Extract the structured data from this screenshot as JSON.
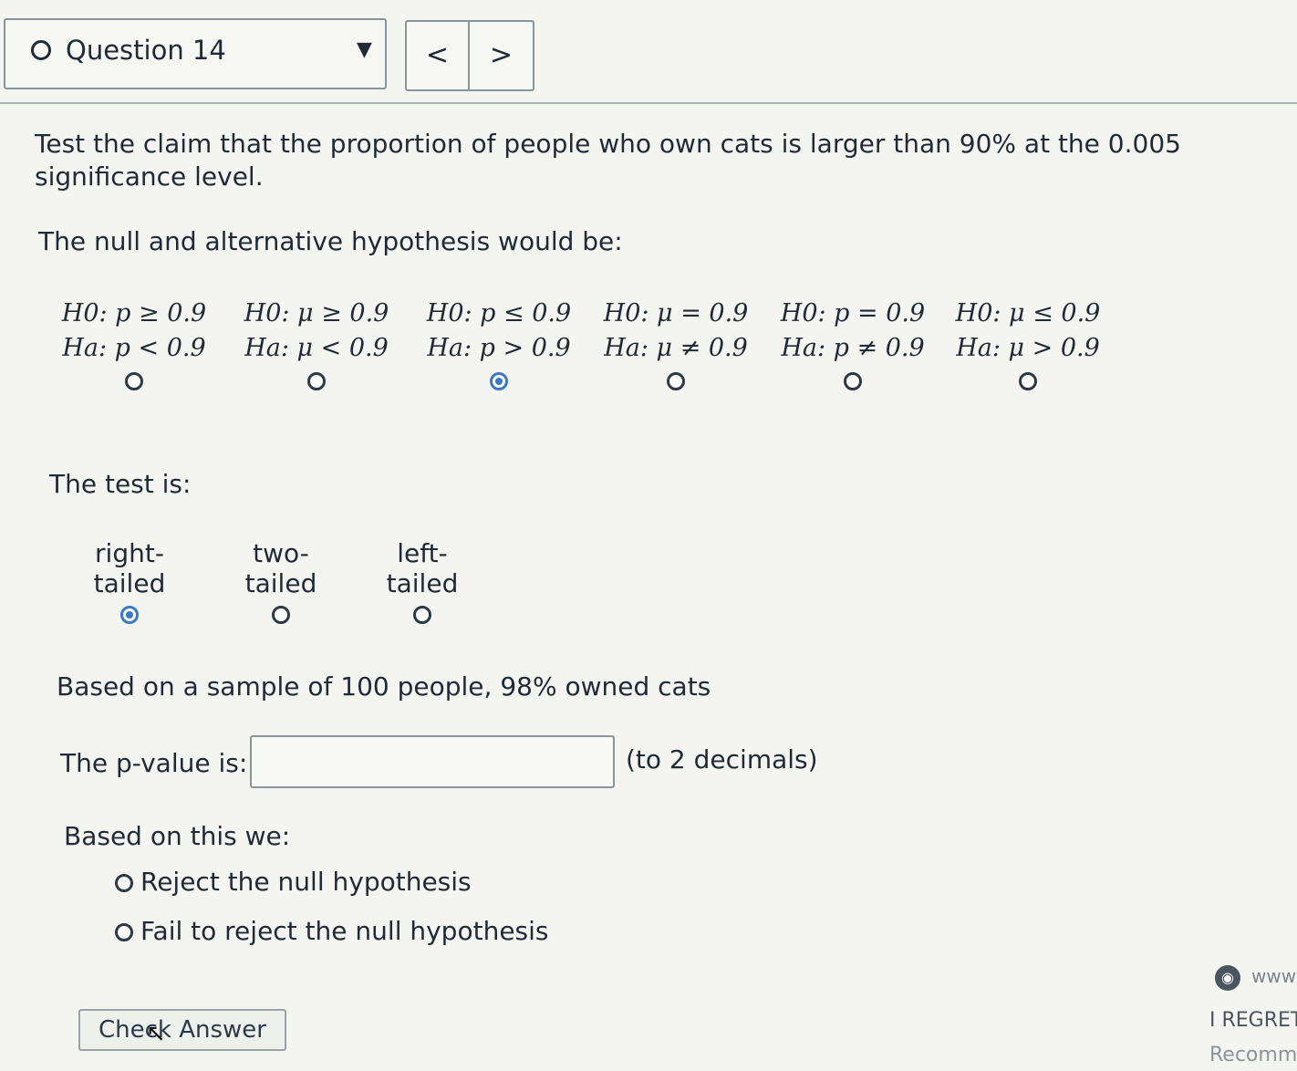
{
  "header": {
    "question_label": "Question 14",
    "dropdown_caret": "▼",
    "prev_label": "<",
    "next_label": ">"
  },
  "question": {
    "claim": "Test the claim that the proportion of people who own cats is larger than 90% at the 0.005 significance level.",
    "hypothesis_prompt": "The null and alternative hypothesis would be:",
    "hypotheses": [
      {
        "h0": "H0: p ≥ 0.9",
        "ha": "Ha: p < 0.9",
        "selected": false
      },
      {
        "h0": "H0: μ ≥ 0.9",
        "ha": "Ha: μ < 0.9",
        "selected": false
      },
      {
        "h0": "H0: p ≤ 0.9",
        "ha": "Ha: p > 0.9",
        "selected": true
      },
      {
        "h0": "H0: μ = 0.9",
        "ha": "Ha: μ ≠ 0.9",
        "selected": false
      },
      {
        "h0": "H0: p = 0.9",
        "ha": "Ha: p ≠ 0.9",
        "selected": false
      },
      {
        "h0": "H0: μ ≤ 0.9",
        "ha": "Ha: μ > 0.9",
        "selected": false
      }
    ],
    "test_prompt": "The test is:",
    "tails": [
      {
        "label": "right-tailed",
        "selected": true
      },
      {
        "label": "two-tailed",
        "selected": false
      },
      {
        "label": "left-tailed",
        "selected": false
      }
    ],
    "sample_text": "Based on a sample of 100 people, 98% owned cats",
    "pvalue_label": "The p-value is:",
    "pvalue_value": "",
    "pvalue_hint": "(to 2 decimals)",
    "decision_prompt": "Based on this we:",
    "decisions": [
      {
        "label": "Reject the null hypothesis",
        "selected": false
      },
      {
        "label": "Fail to reject the null hypothesis",
        "selected": false
      }
    ],
    "check_button": "Check Answer"
  },
  "sidebar_peek": {
    "www": "www",
    "regret": "I REGRET",
    "recomm": "Recomm"
  },
  "colors": {
    "accent": "#3b78c6",
    "text": "#1f2a36",
    "border": "#8a949c"
  }
}
